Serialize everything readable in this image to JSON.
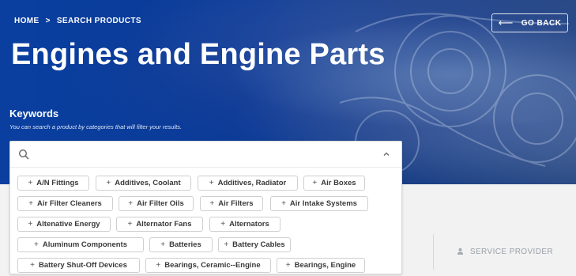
{
  "breadcrumb": {
    "home": "HOME",
    "separator": ">",
    "current": "SEARCH PRODUCTS"
  },
  "go_back": {
    "arrow": "⟵",
    "label": "GO BACK"
  },
  "page_title": "Engines and Engine Parts",
  "keywords": {
    "label": "Keywords",
    "hint": "You can search a product by categories that will filter your results.",
    "search_placeholder": "",
    "chip_prefix": "+",
    "chips": [
      "A/N Fittings",
      "Additives, Coolant",
      "Additives, Radiator",
      "Air Boxes",
      "Air Filter Cleaners",
      "Air Filter Oils",
      "Air Filters",
      "Air Intake Systems",
      "Altenative Energy",
      "Alternator Fans",
      "Alternators",
      "Aluminum Components",
      "Batteries",
      "Battery Cables",
      "Battery Shut-Off Devices",
      "Bearings, Ceramic--Engine",
      "Bearings, Engine"
    ]
  },
  "tabs": {
    "service_provider": "SERVICE PROVIDER"
  },
  "colors": {
    "hero_blue": "#0a3fa0",
    "chip_border": "#cfcfcf",
    "band_gray": "#f2f2f2"
  }
}
